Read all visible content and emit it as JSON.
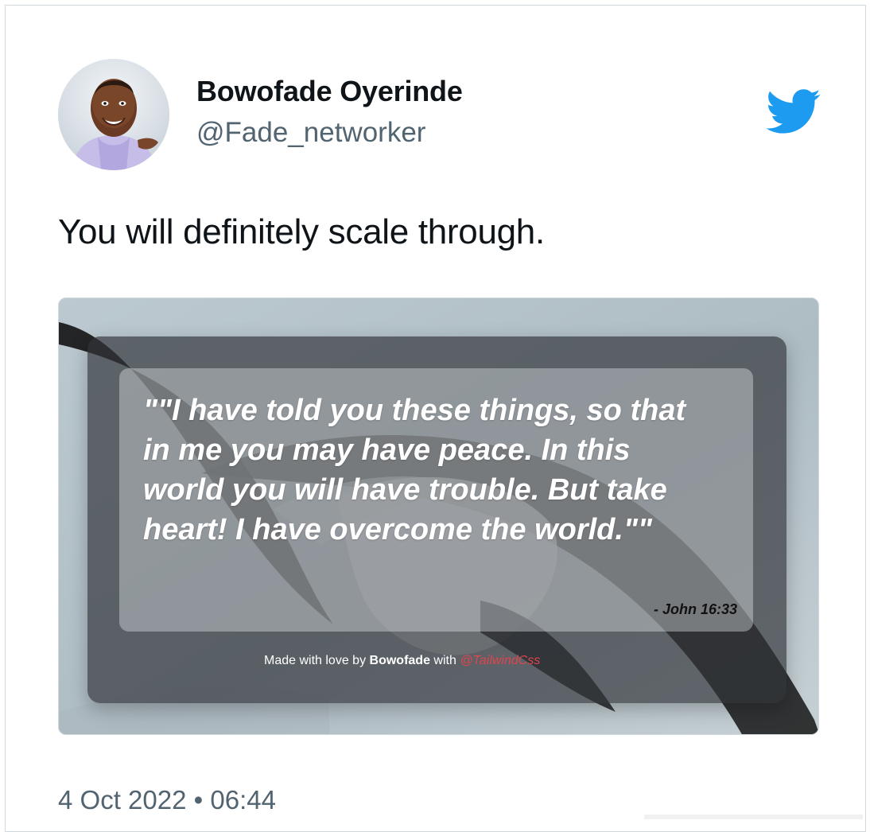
{
  "tweet": {
    "author": {
      "name": "Bowofade Oyerinde",
      "handle": "@Fade_networker"
    },
    "text": "You will definitely scale through.",
    "timestamp": {
      "date": "4 Oct 2022",
      "separator": "•",
      "time": "06:44"
    }
  },
  "media": {
    "quote": "\"\"I have told you these things, so that in me you may have peace. In this world you will have trouble. But take heart! I have overcome the world.\"\"",
    "source": "- John 16:33",
    "footer": {
      "prefix": "Made with love by ",
      "author": "Bowofade",
      "middle": " with ",
      "tag": "@TailwindCss"
    }
  },
  "icons": {
    "brand": "twitter-icon"
  },
  "colors": {
    "brand": "#1d9bf0",
    "primary_text": "#0f1419",
    "secondary_text": "#536471",
    "tailwind_tag": "#e0454d"
  }
}
